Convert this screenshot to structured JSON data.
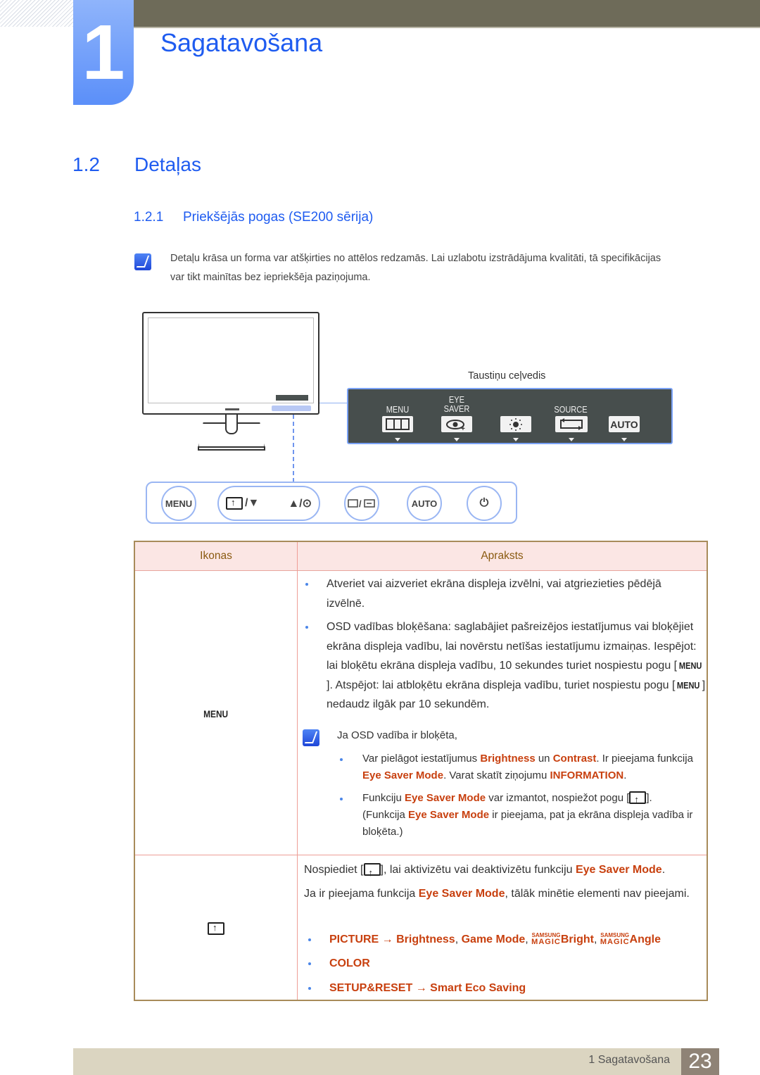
{
  "header": {
    "chapter_number": "1",
    "chapter_title": "Sagatavošana"
  },
  "section": {
    "number": "1.2",
    "title": "Detaļas"
  },
  "subsection": {
    "number": "1.2.1",
    "title": "Priekšējās pogas (SE200 sērija)"
  },
  "note": {
    "text": "Detaļu krāsa un forma var atšķirties no attēlos redzamās. Lai uzlabotu izstrādājuma kvalitāti, tā specifikācijas var tikt mainītas bez iepriekšēja paziņojuma."
  },
  "key_guide": {
    "label": "Taustiņu ceļvedis",
    "keys": [
      {
        "label": "MENU",
        "icon": "menu-grid-icon"
      },
      {
        "label": "EYE SAVER",
        "icon": "eye-saver-icon"
      },
      {
        "label": "",
        "icon": "brightness-icon"
      },
      {
        "label": "SOURCE",
        "icon": "source-icon"
      },
      {
        "label": "",
        "icon": "auto-icon",
        "button_text": "AUTO"
      }
    ]
  },
  "front_panel": {
    "buttons": [
      {
        "label": "MENU"
      },
      {
        "label": "/▼",
        "icon": "eye-saver-icon"
      },
      {
        "label": "▲/⊙"
      },
      {
        "label": "/",
        "icon": "source-enter-icon"
      },
      {
        "label": "AUTO"
      },
      {
        "label": "⏻",
        "icon": "power-icon"
      }
    ]
  },
  "table": {
    "headers": [
      "Ikonas",
      "Apraksts"
    ],
    "rows": [
      {
        "icon_label": "MENU",
        "bullets": [
          "Atveriet vai aizveriet ekrāna displeja izvēlni, vai atgriezieties pēdējā izvēlnē.",
          "OSD vadības bloķēšana: saglabājiet pašreizējos iestatījumus vai bloķējiet ekrāna displeja vadību, lai novērstu netīšas iestatījumu izmaiņas. Iespējot: lai bloķētu ekrāna displeja vadību, 10 sekundes turiet nospiestu pogu [MENU]. Atspējot: lai atbloķētu ekrāna displeja vadību, turiet nospiestu pogu [MENU] nedaudz ilgāk par 10 sekundēm."
        ],
        "note_intro": "Ja OSD vadība ir bloķēta,",
        "sub_bullets": [
          {
            "parts": [
              "Var pielāgot iestatījumus ",
              "Brightness",
              " un ",
              "Contrast",
              ". Ir pieejama funkcija ",
              "Eye Saver Mode",
              ". Varat skatīt ziņojumu ",
              "INFORMATION",
              "."
            ]
          },
          {
            "parts": [
              "Funkciju ",
              "Eye Saver Mode",
              " var izmantot, nospiežot pogu [",
              "].",
              "(Funkcija ",
              "Eye Saver Mode",
              " ir pieejama, pat ja ekrāna displeja vadība ir bloķēta.)"
            ]
          }
        ]
      },
      {
        "icon_label": "eye-saver",
        "para1": [
          "Nospiediet [",
          "], lai aktivizētu vai deaktivizētu funkciju ",
          "Eye Saver Mode",
          "."
        ],
        "para2": [
          "Ja ir pieejama funkcija ",
          "Eye Saver Mode",
          ", tālāk minētie elementi nav pieejami."
        ],
        "items": [
          {
            "parts": [
              "PICTURE",
              " → ",
              "Brightness",
              ", ",
              "Game Mode",
              ", ",
              "Bright",
              ", ",
              "Angle"
            ],
            "magic_top": "SAMSUNG",
            "magic_bottom": "MAGIC"
          },
          {
            "parts": [
              "COLOR"
            ]
          },
          {
            "parts": [
              "SETUP&RESET",
              " → ",
              "Smart Eco Saving"
            ]
          }
        ]
      }
    ]
  },
  "footer": {
    "chapter_label": "1 Sagatavošana",
    "page_number": "23"
  },
  "colors": {
    "heading_blue": "#1f5cf0",
    "highlight": "#c8400f",
    "table_header_bg": "#fbe6e4",
    "footer_bg": "#dbd5c1"
  }
}
